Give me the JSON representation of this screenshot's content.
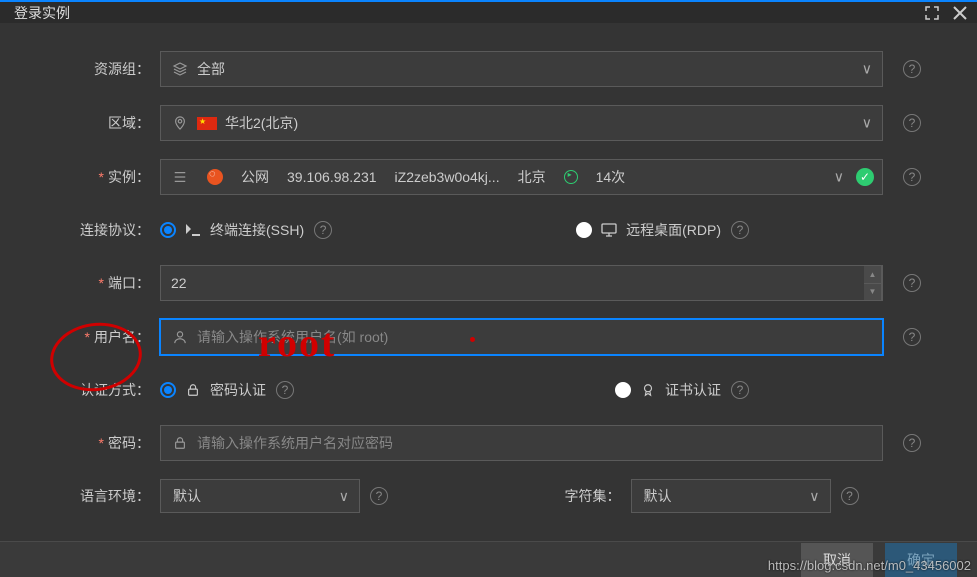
{
  "title": "登录实例",
  "labels": {
    "resource_group": "资源组：",
    "region": "区域：",
    "instance": "实例：",
    "protocol": "连接协议：",
    "port": "端口：",
    "username": "用户名：",
    "auth": "认证方式：",
    "password": "密码：",
    "locale": "语言环境：",
    "charset": "字符集："
  },
  "resource_group": {
    "value": "全部"
  },
  "region": {
    "value": "华北2(北京)"
  },
  "instance": {
    "net": "公网",
    "ip": "39.106.98.231",
    "id": "iZ2zeb3w0o4kj...",
    "loc": "北京",
    "count": "14次"
  },
  "protocol": {
    "opt1": "终端连接(SSH)",
    "opt2": "远程桌面(RDP)"
  },
  "port": {
    "value": "22"
  },
  "username": {
    "placeholder": "请输入操作系统用户名(如 root)"
  },
  "auth": {
    "opt1": "密码认证",
    "opt2": "证书认证"
  },
  "password": {
    "placeholder": "请输入操作系统用户名对应密码"
  },
  "locale": {
    "value": "默认"
  },
  "charset": {
    "value": "默认"
  },
  "buttons": {
    "cancel": "取消",
    "ok": "确定"
  },
  "watermark": "https://blog.csdn.net/m0_43456002",
  "annotation": {
    "text": "root"
  }
}
